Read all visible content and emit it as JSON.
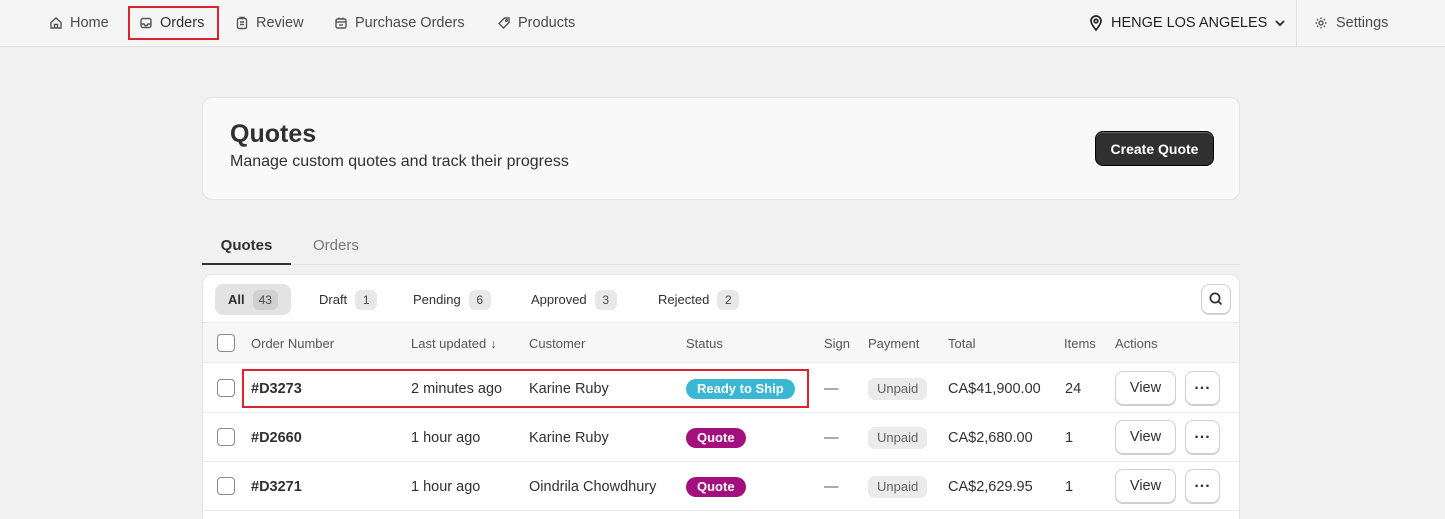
{
  "nav": {
    "items": [
      {
        "label": "Home",
        "icon": "home-icon"
      },
      {
        "label": "Orders",
        "icon": "inbox-icon"
      },
      {
        "label": "Review",
        "icon": "clipboard-icon"
      },
      {
        "label": "Purchase Orders",
        "icon": "receipt-icon"
      },
      {
        "label": "Products",
        "icon": "tag-icon"
      }
    ],
    "active": "Orders",
    "location": "HENGE LOS ANGELES",
    "settings_label": "Settings"
  },
  "header": {
    "title": "Quotes",
    "subtitle": "Manage custom quotes and track their progress",
    "create_button": "Create Quote"
  },
  "tabs": [
    "Quotes",
    "Orders"
  ],
  "active_tab": "Quotes",
  "filters": [
    {
      "label": "All",
      "count": "43"
    },
    {
      "label": "Draft",
      "count": "1"
    },
    {
      "label": "Pending",
      "count": "6"
    },
    {
      "label": "Approved",
      "count": "3"
    },
    {
      "label": "Rejected",
      "count": "2"
    }
  ],
  "columns": {
    "order_number": "Order Number",
    "last_updated": "Last updated",
    "last_updated_sort": "↓",
    "customer": "Customer",
    "status": "Status",
    "sign": "Sign",
    "payment": "Payment",
    "total": "Total",
    "items": "Items",
    "actions": "Actions"
  },
  "rows": [
    {
      "order": "#D3273",
      "updated": "2 minutes ago",
      "customer": "Karine Ruby",
      "status": "Ready to Ship",
      "sign": "—",
      "payment": "Unpaid",
      "total": "CA$41,900.00",
      "items": "24",
      "view": "View"
    },
    {
      "order": "#D2660",
      "updated": "1 hour ago",
      "customer": "Karine Ruby",
      "status": "Quote",
      "sign": "—",
      "payment": "Unpaid",
      "total": "CA$2,680.00",
      "items": "1",
      "view": "View"
    },
    {
      "order": "#D3271",
      "updated": "1 hour ago",
      "customer": "Oindrila Chowdhury",
      "status": "Quote",
      "sign": "—",
      "payment": "Unpaid",
      "total": "CA$2,629.95",
      "items": "1",
      "view": "View"
    }
  ],
  "colors": {
    "highlight": "#d9232e",
    "ready_to_ship": "#3ab7d4",
    "quote": "#a3107d",
    "primary_button": "#303030"
  }
}
